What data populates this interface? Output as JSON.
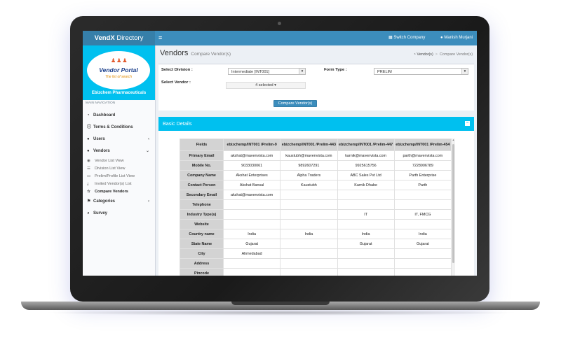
{
  "app": {
    "brand_prefix": "VendX",
    "brand_suffix": " Directory",
    "menu_icon": "≡",
    "switch_company": "Switch Company",
    "user_name": "Manish Murjani"
  },
  "sidebar": {
    "logo_title": "Vendor Portal",
    "logo_tagline": "The list of search",
    "company": "Ebizchem Pharmaceuticals",
    "nav_header": "MAIN NAVIGATION",
    "items": [
      {
        "label": "Dashboard",
        "icon": "tachometer-icon"
      },
      {
        "label": "Terms & Conditions",
        "icon": "info-icon"
      },
      {
        "label": "Users",
        "icon": "user-icon"
      },
      {
        "label": "Vendors",
        "icon": "users-icon"
      },
      {
        "label": "Categories",
        "icon": "tags-icon"
      },
      {
        "label": "Survey",
        "icon": "pie-chart-icon"
      }
    ],
    "vendor_sub": [
      {
        "label": "Vendor List View"
      },
      {
        "label": "Division List View"
      },
      {
        "label": "Prelim/Profile List View"
      },
      {
        "label": "Invited Vendor(s) List"
      },
      {
        "label": "Compare Vendors"
      }
    ]
  },
  "header": {
    "title": "Vendors",
    "subtitle": "Compare Vendor(s)",
    "crumb_root": "Vendor(s)",
    "crumb_current": "Compare Vendor(s)"
  },
  "filters": {
    "division_label": "Select Division :",
    "division_value": "Intermediate [INT001]",
    "form_type_label": "Form Type :",
    "form_type_value": "PRELIM",
    "vendor_label": "Select Vendor :",
    "vendor_value": "4 selected ▾",
    "compare_button": "Compare Vendor(s)"
  },
  "details": {
    "title": "Basic Details",
    "collapse_icon": "−",
    "columns": [
      "Fields",
      "ebizchemp/INT001 /Prelim-9",
      "ebizchemp/INT001 /Prelim-443",
      "ebizchemp/INT001 /Prelim-447",
      "ebizchemp/INT001 /Prelim-454"
    ],
    "rows": [
      [
        "Primary Email",
        "akshat@mavenvista.com",
        "kaustubh@mavenvista.com",
        "karnik@mavenvista.com",
        "parth@mavenvista.com"
      ],
      [
        "Mobile No.",
        "9033030061",
        "9892607291",
        "9925615756",
        "7228906789"
      ],
      [
        "Company Name",
        "Akshat Enterprises",
        "Alpha Traders",
        "ABC Sales Pvt Ltd",
        "Parth Enterprise"
      ],
      [
        "Contact Person",
        "Akshat Bansal",
        "Kaustubh",
        "Karnik Dhabe",
        "Parth"
      ],
      [
        "Secondary Email",
        "akshat@mavenvista.com",
        "",
        "",
        ""
      ],
      [
        "Telephone",
        "",
        "",
        "",
        ""
      ],
      [
        "Industry Type(s)",
        "",
        "",
        "IT",
        "IT, FMCG"
      ],
      [
        "Website",
        "",
        "",
        "",
        ""
      ],
      [
        "Country name",
        "India",
        "India",
        "India",
        "India"
      ],
      [
        "State Name",
        "Gujarat",
        "",
        "Gujarat",
        "Gujarat"
      ],
      [
        "City",
        "Ahmedabad",
        "",
        "",
        ""
      ],
      [
        "Address",
        "",
        "",
        "",
        ""
      ],
      [
        "Pincode",
        "",
        "",
        "",
        ""
      ]
    ]
  }
}
